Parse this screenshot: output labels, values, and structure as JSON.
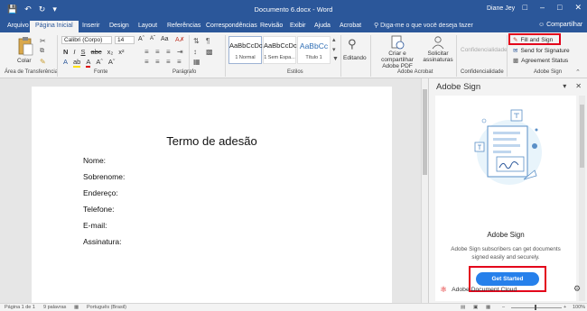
{
  "titlebar": {
    "doc_title": "Documento 6.docx - Word",
    "user": "Diane Jey",
    "accent": "#2b579a"
  },
  "tabs": [
    {
      "label": "Arquivo"
    },
    {
      "label": "Página Inicial",
      "active": true
    },
    {
      "label": "Inserir"
    },
    {
      "label": "Design"
    },
    {
      "label": "Layout"
    },
    {
      "label": "Referências"
    },
    {
      "label": "Correspondências"
    },
    {
      "label": "Revisão"
    },
    {
      "label": "Exibir"
    },
    {
      "label": "Ajuda"
    },
    {
      "label": "Acrobat"
    }
  ],
  "tellme": "Diga-me o que você deseja fazer",
  "share": "Compartilhar",
  "ribbon": {
    "paste_label": "Colar",
    "font_name": "Calibri (Corpo)",
    "font_size": "14",
    "styles": [
      {
        "sample": "AaBbCcDc",
        "name": "1 Normal"
      },
      {
        "sample": "AaBbCcDc",
        "name": "1 Sem Espa..."
      },
      {
        "sample": "AaBbCc",
        "name": "Título 1"
      }
    ],
    "editing_label": "Editando",
    "acrobat_create": "Criar e compartilhar Adobe PDF",
    "acrobat_request": "Solicitar assinaturas",
    "confidentiality": "Confidencialidade",
    "adobe_sign_items": [
      "Fill and Sign",
      "Send for Signature",
      "Agreement Status"
    ],
    "groups": {
      "clipboard": "Área de Transferência",
      "font": "Fonte",
      "paragraph": "Parágrafo",
      "styles": "Estilos",
      "acrobat": "Adobe Acrobat",
      "confidentiality": "Confidencialidade",
      "adobe_sign": "Adobe Sign"
    }
  },
  "document": {
    "heading": "Termo de adesão",
    "fields": [
      "Nome:",
      "Sobrenome:",
      "Endereço:",
      "Telefone:",
      "E-mail:",
      "Assinatura:"
    ]
  },
  "pane": {
    "title": "Adobe Sign",
    "card_title": "Adobe Sign",
    "description": "Adobe Sign subscribers can get documents signed easily and securely.",
    "cta": "Get Started",
    "footer": "Adobe Document Cloud",
    "highlight_color": "#e3001b",
    "button_color": "#2680eb"
  },
  "status": {
    "page": "Página 1 de 1",
    "words": "9 palavras",
    "language": "Português (Brasil)",
    "zoom": "100%"
  }
}
